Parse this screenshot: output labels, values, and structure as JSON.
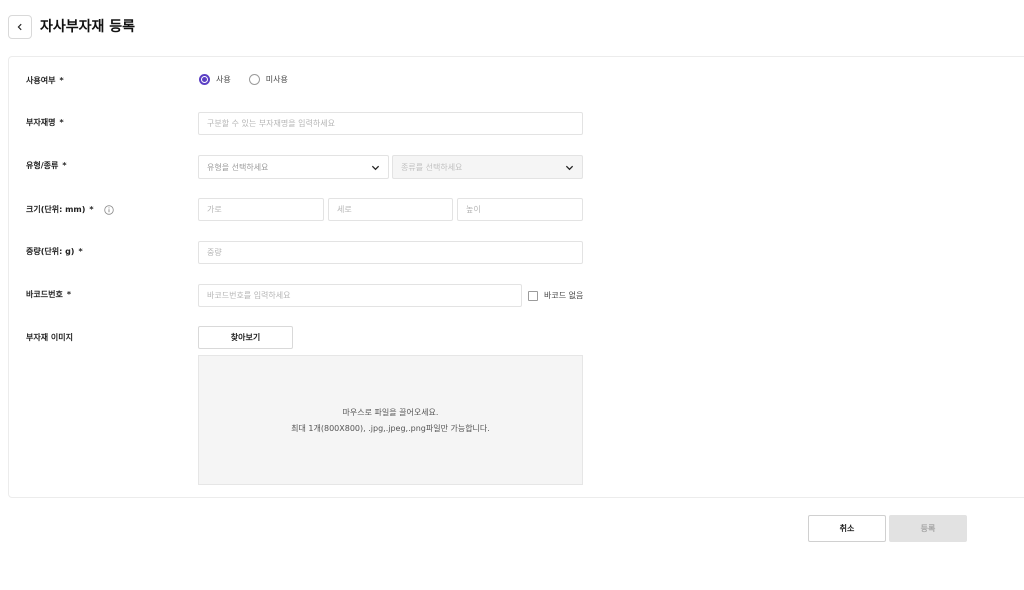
{
  "header": {
    "title": "자사부자재 등록"
  },
  "form": {
    "usage": {
      "label": "사용여부",
      "required_mark": "*",
      "options": [
        {
          "label": "사용",
          "checked": true
        },
        {
          "label": "미사용",
          "checked": false
        }
      ]
    },
    "name": {
      "label": "부자재명",
      "required_mark": "*",
      "placeholder": "구분할 수 있는 부자재명을 입력하세요"
    },
    "type_kind": {
      "label": "유형/종류",
      "required_mark": "*",
      "type_placeholder": "유형을 선택하세요",
      "kind_placeholder": "종류를 선택하세요"
    },
    "size": {
      "label": "크기(단위: mm)",
      "required_mark": "*",
      "width_placeholder": "가로",
      "length_placeholder": "세로",
      "height_placeholder": "높이"
    },
    "weight": {
      "label": "중량(단위: g)",
      "required_mark": "*",
      "placeholder": "중량"
    },
    "barcode": {
      "label": "바코드번호",
      "required_mark": "*",
      "placeholder": "바코드번호를 입력하세요",
      "no_barcode_label": "바코드 없음"
    },
    "image": {
      "label": "부자재 이미지",
      "browse_label": "찾아보기",
      "drop_line1": "마우스로 파일을 끌어오세요.",
      "drop_line2": "최대 1개(800X800), .jpg,.jpeg,.png파일만 가능합니다."
    }
  },
  "footer": {
    "cancel_label": "취소",
    "submit_label": "등록"
  },
  "colors": {
    "accent": "#5b3fc4"
  }
}
